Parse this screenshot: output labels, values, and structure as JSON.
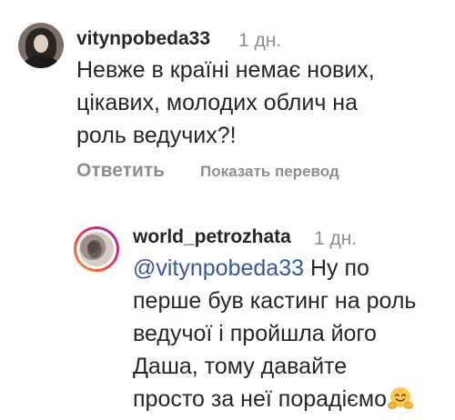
{
  "comments": [
    {
      "username": "vitynpobeda33",
      "time": "1 дн.",
      "lines": [
        "Невже в країні немає нових,",
        "цікавих, молодих облич на",
        "роль ведучих?!"
      ],
      "reply_label": "Ответить",
      "translate_label": "Показать перевод"
    },
    {
      "username": "world_petrozhata",
      "time": "1 дн.",
      "mention": "@vitynpobeda33",
      "line1_rest": " Ну по",
      "lines": [
        "перше був кастинг на  роль",
        "ведучої і пройшла його",
        "Даша, тому давайте",
        "просто за неї порадіємо"
      ],
      "emoji": "hugging-face"
    }
  ]
}
